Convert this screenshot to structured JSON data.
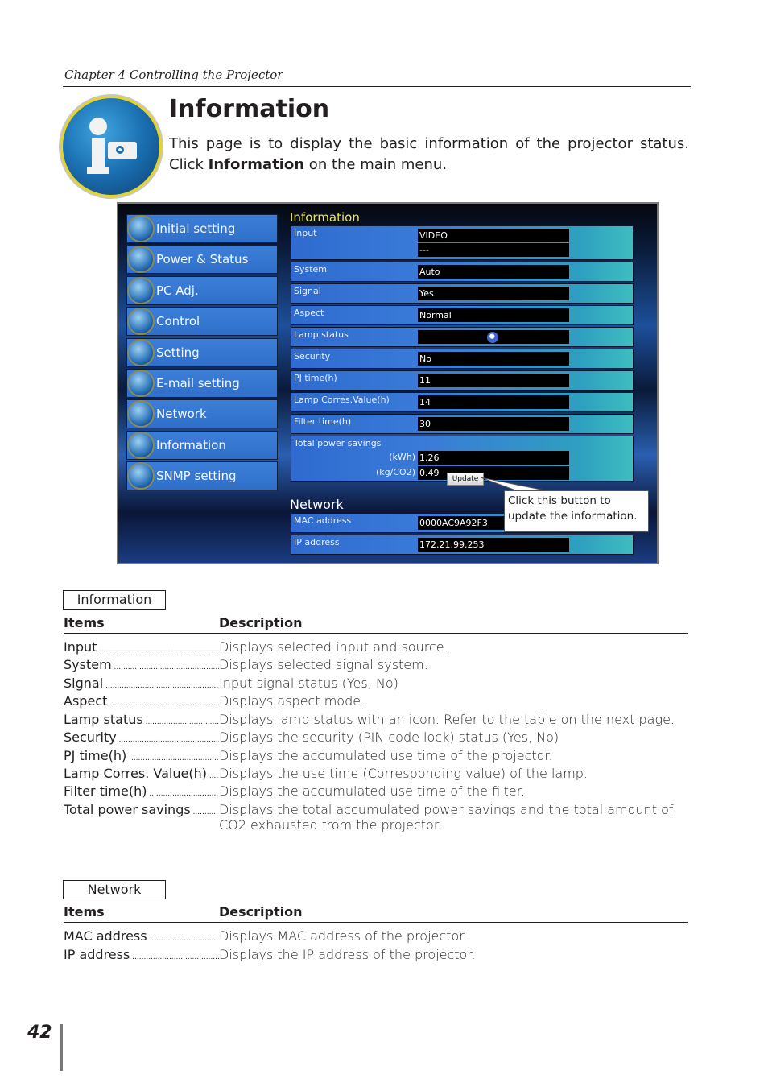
{
  "header": {
    "chapter": "Chapter 4 Controlling the Projector"
  },
  "section": {
    "title": "Information",
    "intro_before": "This page is to display the basic information of the projector status. Click ",
    "intro_bold": "Information",
    "intro_after": " on the main menu.",
    "icon": "information-projector-icon"
  },
  "screenshot": {
    "menu": [
      {
        "label": "Initial setting",
        "icon": "initial-setting-icon"
      },
      {
        "label": "Power & Status",
        "icon": "power-status-icon"
      },
      {
        "label": "PC Adj.",
        "icon": "pc-adj-icon"
      },
      {
        "label": "Control",
        "icon": "control-icon"
      },
      {
        "label": "Setting",
        "icon": "setting-icon"
      },
      {
        "label": "E-mail setting",
        "icon": "email-icon"
      },
      {
        "label": "Network",
        "icon": "network-icon"
      },
      {
        "label": "Information",
        "icon": "information-icon"
      },
      {
        "label": "SNMP setting",
        "icon": "snmp-icon"
      }
    ],
    "info_title": "Information",
    "info_rows": {
      "input": {
        "label": "Input",
        "value1": "VIDEO",
        "value2": "---"
      },
      "system": {
        "label": "System",
        "value": "Auto"
      },
      "signal": {
        "label": "Signal",
        "value": "Yes"
      },
      "aspect": {
        "label": "Aspect",
        "value": "Normal"
      },
      "lamp_status": {
        "label": "Lamp status",
        "icon": "lamp-bulb-icon"
      },
      "security": {
        "label": "Security",
        "value": "No"
      },
      "pj_time": {
        "label": "PJ time(h)",
        "value": "11"
      },
      "lamp_corres": {
        "label": "Lamp Corres.Value(h)",
        "value": "14"
      },
      "filter_time": {
        "label": "Filter time(h)",
        "value": "30"
      },
      "power_savings": {
        "label": "Total power savings",
        "kwh_label": "(kWh)",
        "kwh_value": "1.26",
        "co2_label": "(kg/CO2)",
        "co2_value": "0.49"
      }
    },
    "update_button": "Update",
    "network_title": "Network",
    "network_rows": {
      "mac": {
        "label": "MAC address",
        "value": "0000AC9A92F3"
      },
      "ip": {
        "label": "IP address",
        "value": "172.21.99.253"
      }
    },
    "callout": "Click this button to update the information."
  },
  "info_table": {
    "tag": "Information",
    "col_items": "Items",
    "col_description": "Description",
    "rows": [
      {
        "item": "Input",
        "desc": "Displays selected input and source."
      },
      {
        "item": "System",
        "desc": "Displays selected signal system."
      },
      {
        "item": "Signal",
        "desc": "Input signal status (Yes, No)"
      },
      {
        "item": "Aspect",
        "desc": "Displays aspect mode."
      },
      {
        "item": "Lamp status",
        "desc": "Displays lamp status with an icon. Refer to the table on the next page."
      },
      {
        "item": "Security",
        "desc": "Displays the security (PIN code lock) status (Yes, No)"
      },
      {
        "item": "PJ time(h)",
        "desc": "Displays the accumulated use time of the projector."
      },
      {
        "item": "Lamp Corres. Value(h)",
        "desc": "Displays the use time (Corresponding value) of the lamp."
      },
      {
        "item": "Filter time(h)",
        "desc": "Displays the accumulated use time of the filter."
      },
      {
        "item": "Total power savings",
        "desc": "Displays the total accumulated power savings and the total amount of CO2 exhausted from the projector."
      }
    ]
  },
  "network_table": {
    "tag": "Network",
    "col_items": "Items",
    "col_description": "Description",
    "rows": [
      {
        "item": "MAC address",
        "desc": "Displays MAC address of the projector."
      },
      {
        "item": "IP address",
        "desc": "Displays the IP address of the projector."
      }
    ]
  },
  "footer": {
    "page_number": "42"
  }
}
